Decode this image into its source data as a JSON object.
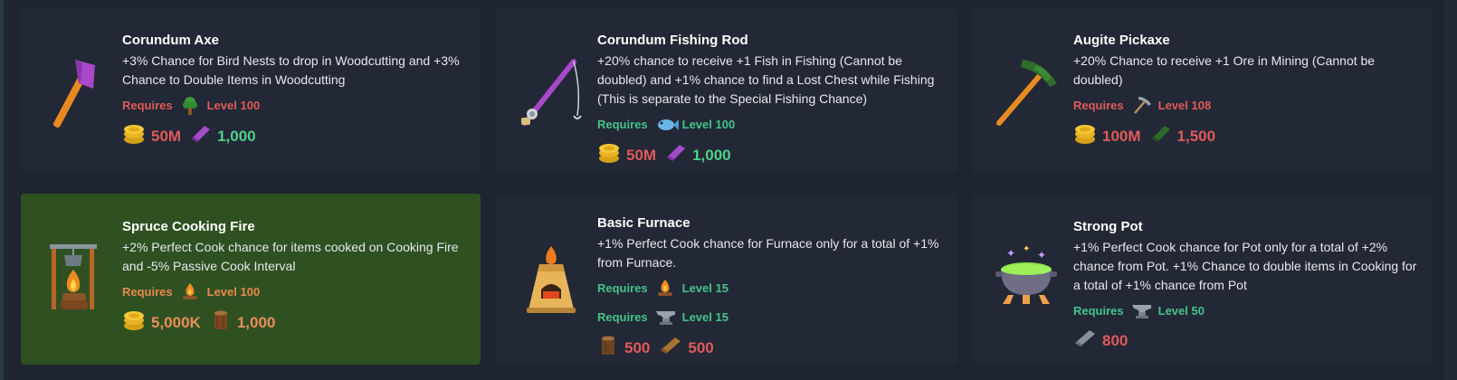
{
  "cards": [
    {
      "title": "Corundum Axe",
      "desc": "+3% Chance for Bird Nests to drop in Woodcutting and +3% Chance to Double Items in Woodcutting",
      "requires_label": "Requires",
      "req_level": "Level 100",
      "req_icon": "tree-icon",
      "req_met": false,
      "costs": [
        {
          "icon": "gold-coins-icon",
          "value": "50M"
        },
        {
          "icon": "corundum-bar-icon",
          "value": "1,000"
        }
      ]
    },
    {
      "title": "Corundum Fishing Rod",
      "desc": "+20% chance to receive +1 Fish in Fishing (Cannot be doubled) and +1% chance to find a Lost Chest while Fishing (This is separate to the Special Fishing Chance)",
      "requires_label": "Requires",
      "req_level": "Level 100",
      "req_icon": "fish-icon",
      "req_met": true,
      "costs": [
        {
          "icon": "gold-coins-icon",
          "value": "50M"
        },
        {
          "icon": "corundum-bar-icon",
          "value": "1,000"
        }
      ]
    },
    {
      "title": "Augite Pickaxe",
      "desc": "+20% Chance to receive +1 Ore in Mining (Cannot be doubled)",
      "requires_label": "Requires",
      "req_level": "Level 108",
      "req_icon": "pickaxe-icon",
      "req_met": false,
      "costs": [
        {
          "icon": "gold-coins-icon",
          "value": "100M"
        },
        {
          "icon": "augite-bar-icon",
          "value": "1,500"
        }
      ]
    },
    {
      "title": "Spruce Cooking Fire",
      "desc": "+2% Perfect Cook chance for items cooked on Cooking Fire and -5% Passive Cook Interval",
      "requires_label": "Requires",
      "req_level": "Level 100",
      "req_icon": "campfire-icon",
      "req_met": false,
      "costs": [
        {
          "icon": "gold-coins-icon",
          "value": "5,000K"
        },
        {
          "icon": "spruce-log-icon",
          "value": "1,000"
        }
      ]
    },
    {
      "title": "Basic Furnace",
      "desc": "+1% Perfect Cook chance for Furnace only for a total of +1% from Furnace.",
      "requirements": [
        {
          "label": "Requires",
          "icon": "campfire-icon",
          "level": "Level 15"
        },
        {
          "label": "Requires",
          "icon": "anvil-icon",
          "level": "Level 15"
        }
      ],
      "costs": [
        {
          "icon": "log-icon",
          "value": "500"
        },
        {
          "icon": "plank-icon",
          "value": "500"
        }
      ]
    },
    {
      "title": "Strong Pot",
      "desc": "+1% Perfect Cook chance for Pot only for a total of +2% chance from Pot. +1% Chance to double items in Cooking for a total of +1% chance from Pot",
      "requires_label": "Requires",
      "req_level": "Level 50",
      "req_icon": "anvil-icon",
      "req_met": true,
      "costs": [
        {
          "icon": "iron-bar-icon",
          "value": "800"
        }
      ]
    }
  ]
}
